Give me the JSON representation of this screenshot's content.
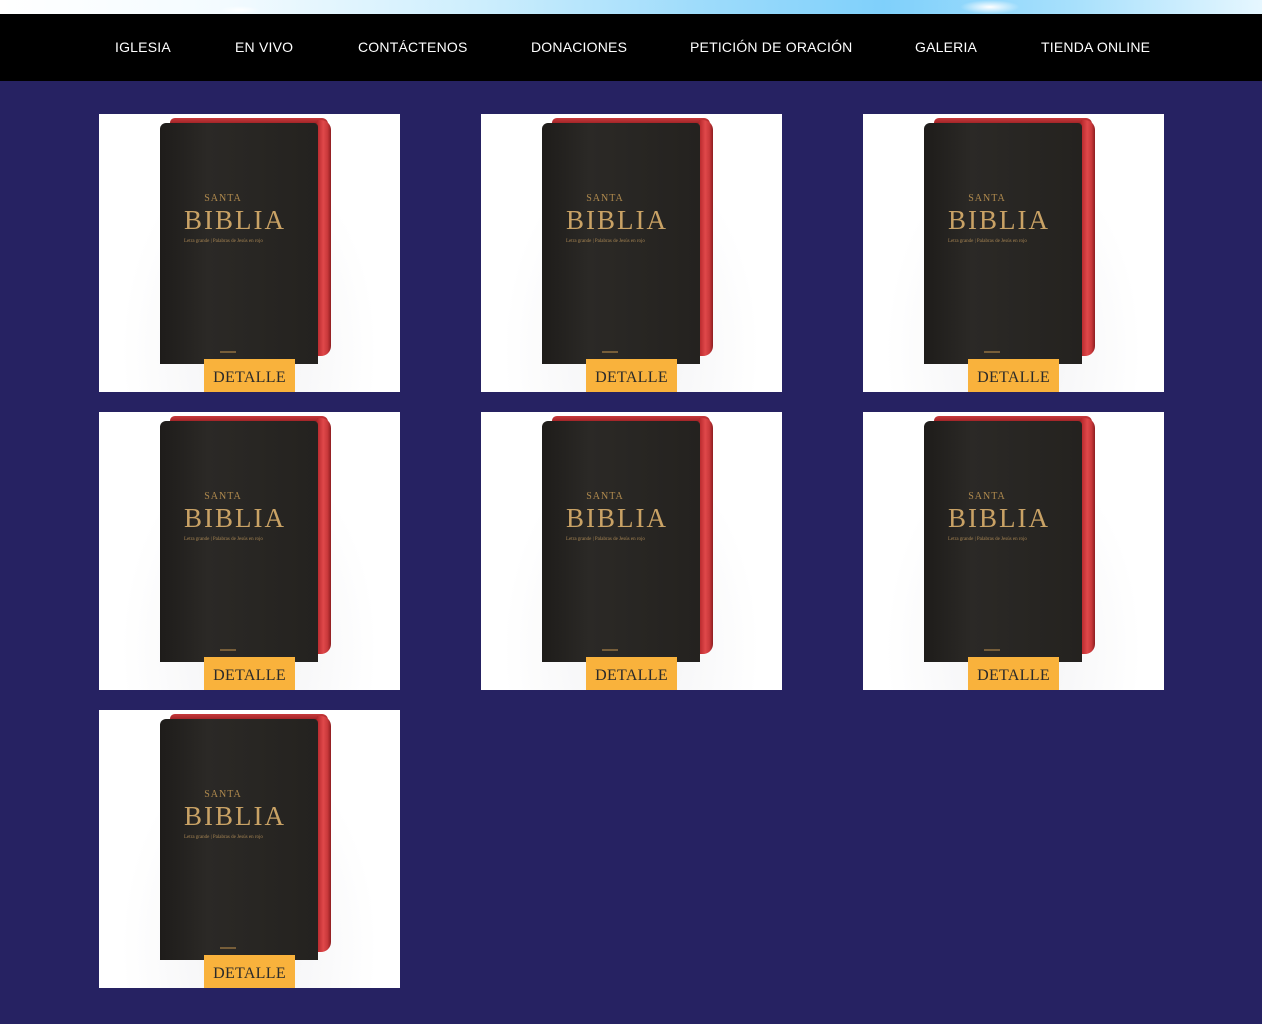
{
  "nav": {
    "items": [
      {
        "label": "IGLESIA"
      },
      {
        "label": "EN VIVO"
      },
      {
        "label": "CONTÁCTENOS"
      },
      {
        "label": "DONACIONES"
      },
      {
        "label": "PETICIÓN DE ORACIÓN"
      },
      {
        "label": "GALERIA"
      },
      {
        "label": "TIENDA ONLINE"
      }
    ]
  },
  "product_image": {
    "title_small": "SANTA",
    "title_large": "BIBLIA",
    "subtitle": "Letra grande | Palabras de Jesús en rojo"
  },
  "products": [
    {
      "button_label": "DETALLE"
    },
    {
      "button_label": "DETALLE"
    },
    {
      "button_label": "DETALLE"
    },
    {
      "button_label": "DETALLE"
    },
    {
      "button_label": "DETALLE"
    },
    {
      "button_label": "DETALLE"
    },
    {
      "button_label": "DETALLE"
    }
  ],
  "colors": {
    "page_background": "#262262",
    "nav_background": "#000000",
    "button_background": "#f9b23c"
  }
}
